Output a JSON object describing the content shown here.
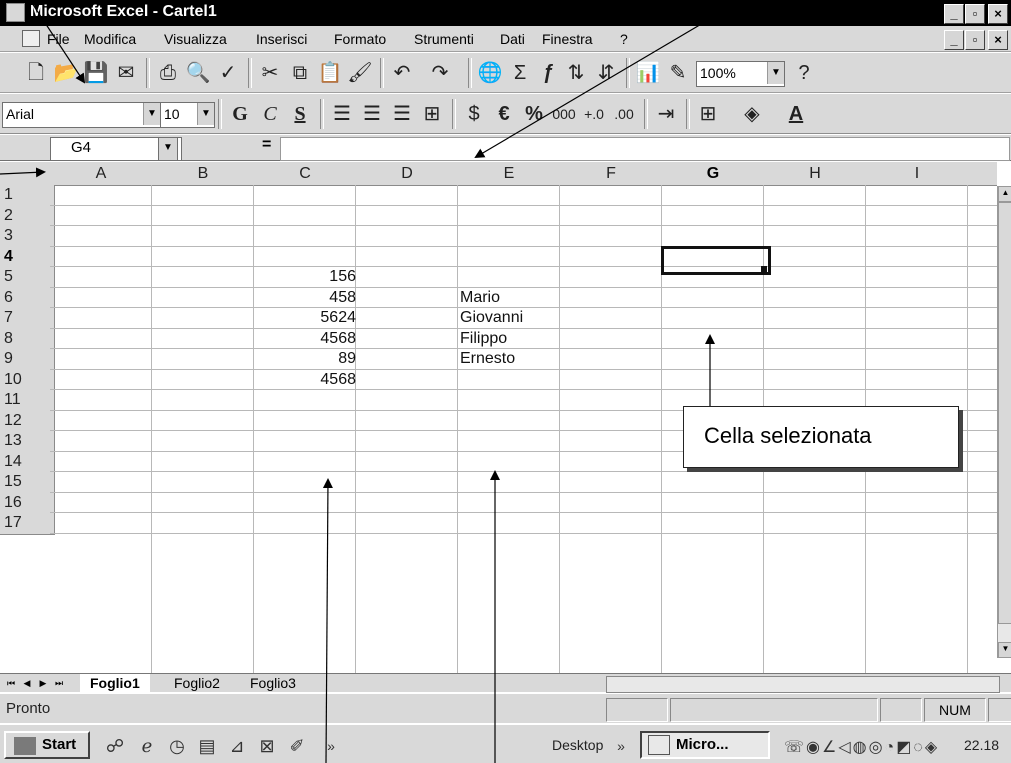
{
  "window": {
    "title": "Microsoft Excel - Cartel1",
    "controls": [
      "_",
      "·",
      "×"
    ],
    "doc_controls": [
      "_",
      "·",
      "×"
    ]
  },
  "menu": [
    "File",
    "Modifica",
    "Visualizza",
    "Inserisci",
    "Formato",
    "Strumenti",
    "Dati",
    "Finestra",
    "?"
  ],
  "toolbar1": {
    "icons": [
      "new-icon",
      "open-icon",
      "save-icon",
      "mail-icon",
      "print-icon",
      "print-preview-icon",
      "spelling-icon",
      "cut-icon",
      "copy-icon",
      "paste-icon",
      "format-painter-icon",
      "undo-icon",
      "redo-icon",
      "hyperlink-icon",
      "autosum-icon",
      "function-icon",
      "sort-asc-icon",
      "sort-desc-icon",
      "chart-wizard-icon",
      "drawing-icon",
      "help-icon"
    ],
    "zoom": "100%"
  },
  "toolbar2": {
    "font": "Arial",
    "size": "10",
    "bold": "G",
    "italic": "C",
    "underline": "S",
    "percent": "%",
    "thousands": "000",
    "euro": "€"
  },
  "formula_bar": {
    "name_box": "G4",
    "equals": "=",
    "content": ""
  },
  "grid": {
    "columns": [
      "A",
      "B",
      "C",
      "D",
      "E",
      "F",
      "G",
      "H",
      "I"
    ],
    "rows": [
      "1",
      "2",
      "3",
      "4",
      "5",
      "6",
      "7",
      "8",
      "9",
      "10",
      "11",
      "12",
      "13",
      "14",
      "15",
      "16",
      "17"
    ],
    "selected_column": "G",
    "selected_row": "4",
    "col_c_values": [
      "156",
      "458",
      "5624",
      "4568",
      "89",
      "4568"
    ],
    "col_e_values": [
      "Mario",
      "Giovanni",
      "Filippo",
      "Ernesto"
    ]
  },
  "sheets": [
    "Foglio1",
    "Foglio2",
    "Foglio3"
  ],
  "status": {
    "ready": "Pronto",
    "num": "NUM"
  },
  "taskbar": {
    "start": "Start",
    "desktop": "Desktop",
    "task": "Micro...",
    "clock": "22.18",
    "more": "»"
  },
  "callout": "Cella selezionata"
}
